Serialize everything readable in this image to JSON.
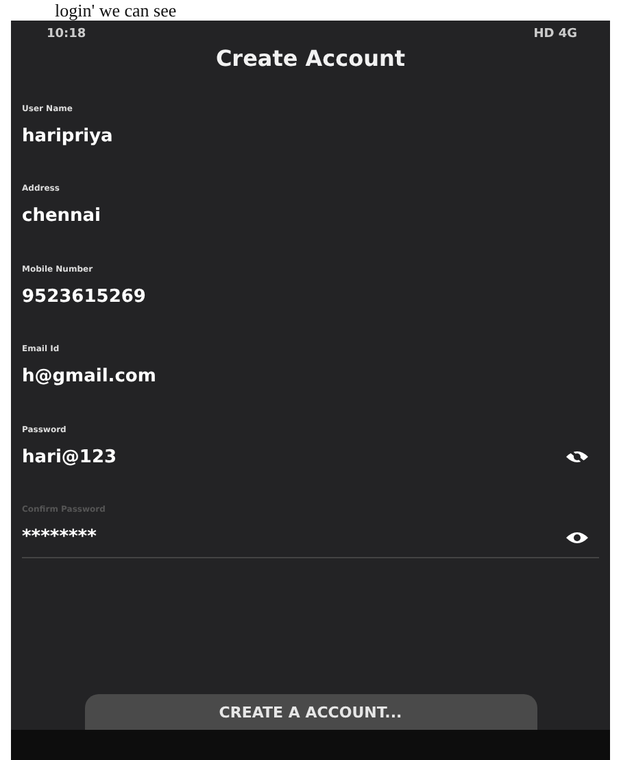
{
  "caption": "login' we can see",
  "status_bar": {
    "time": "10:18",
    "indicators": "HD 4G"
  },
  "title": "Create Account",
  "fields": [
    {
      "label": "User Name",
      "value": "haripriya"
    },
    {
      "label": "Address",
      "value": "chennai"
    },
    {
      "label": "Mobile Number",
      "value": "9523615269"
    },
    {
      "label": "Email Id",
      "value": "h@gmail.com"
    },
    {
      "label": "Password",
      "value": "hari@123",
      "kind": "password",
      "masked": false
    },
    {
      "placeholder": "Confirm Password",
      "value": "********",
      "kind": "password",
      "masked": true
    }
  ],
  "button": "CREATE A ACCOUNT..."
}
